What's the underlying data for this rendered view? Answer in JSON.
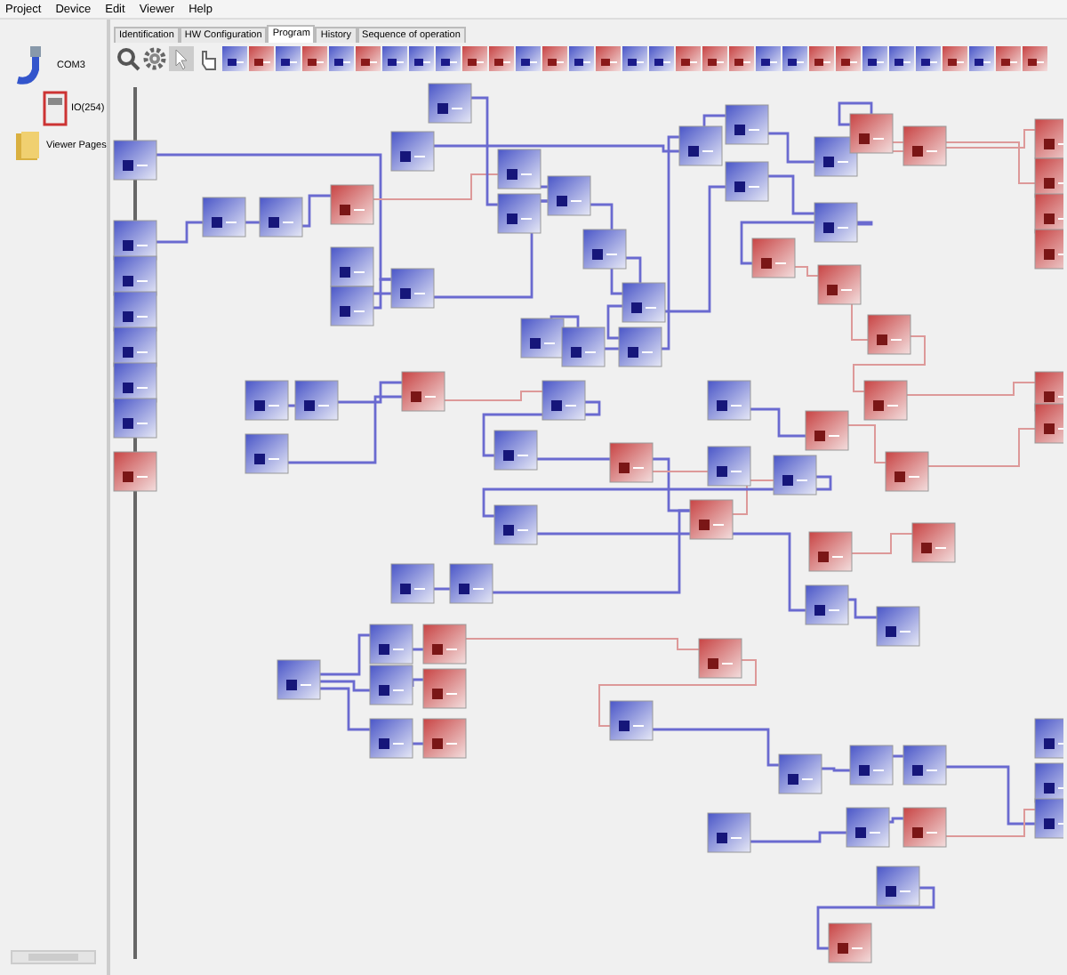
{
  "menu": [
    "Project",
    "Device",
    "Edit",
    "Viewer",
    "Help"
  ],
  "tree": [
    {
      "label": "COM3",
      "kind": "port",
      "children": [
        {
          "label": "IO(254)",
          "kind": "device"
        }
      ]
    },
    {
      "label": "Viewer Pages",
      "kind": "folder"
    }
  ],
  "tabs": [
    {
      "label": "Identification",
      "selected": false
    },
    {
      "label": "HW Configuration",
      "selected": false
    },
    {
      "label": "Program",
      "selected": true
    },
    {
      "label": "History",
      "selected": false
    },
    {
      "label": "Sequence of operation",
      "selected": false
    }
  ]
}
